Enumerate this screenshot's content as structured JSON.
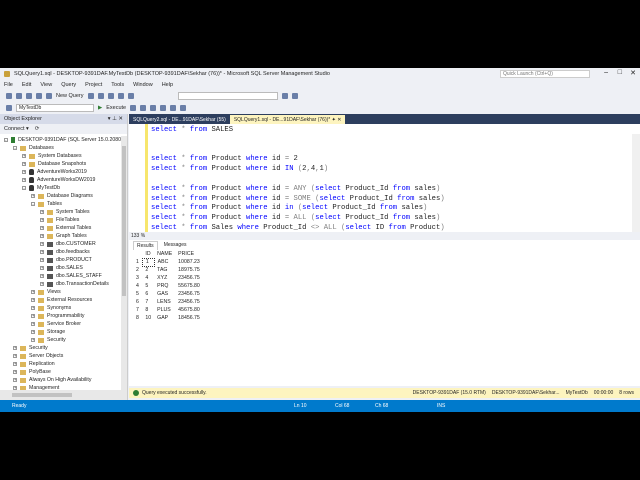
{
  "window": {
    "title": "SQLQuery1.sql - DESKTOP-9391DAF.MyTestDb (DESKTOP-9391DAF\\Sekhar (76))* - Microsoft SQL Server Management Studio",
    "quick_launch": "Quick Launch (Ctrl+Q)"
  },
  "menu": [
    "File",
    "Edit",
    "View",
    "Query",
    "Project",
    "Tools",
    "Window",
    "Help"
  ],
  "toolbar": {
    "new_query": "New Query",
    "database": "MyTestDb",
    "execute": "Execute"
  },
  "object_explorer": {
    "title": "Object Explorer",
    "connect": "Connect ▾",
    "nodes": [
      {
        "label": "DESKTOP-9391DAF (SQL Server 15.0.2080",
        "level": 0,
        "icon": "server",
        "exp": "-"
      },
      {
        "label": "Databases",
        "level": 1,
        "icon": "folder",
        "exp": "-"
      },
      {
        "label": "System Databases",
        "level": 2,
        "icon": "folder",
        "exp": "+"
      },
      {
        "label": "Database Snapshots",
        "level": 2,
        "icon": "folder",
        "exp": "+"
      },
      {
        "label": "AdventureWorks2019",
        "level": 2,
        "icon": "db",
        "exp": "+"
      },
      {
        "label": "AdventureWorksDW2019",
        "level": 2,
        "icon": "db",
        "exp": "+"
      },
      {
        "label": "MyTestDb",
        "level": 2,
        "icon": "db",
        "exp": "-"
      },
      {
        "label": "Database Diagrams",
        "level": 3,
        "icon": "folder",
        "exp": "+"
      },
      {
        "label": "Tables",
        "level": 3,
        "icon": "folder",
        "exp": "-"
      },
      {
        "label": "System Tables",
        "level": 4,
        "icon": "folder",
        "exp": "+"
      },
      {
        "label": "FileTables",
        "level": 4,
        "icon": "folder",
        "exp": "+"
      },
      {
        "label": "External Tables",
        "level": 4,
        "icon": "folder",
        "exp": "+"
      },
      {
        "label": "Graph Tables",
        "level": 4,
        "icon": "folder",
        "exp": "+"
      },
      {
        "label": "dbo.CUSTOMER",
        "level": 4,
        "icon": "table",
        "exp": "+"
      },
      {
        "label": "dbo.feedbacks",
        "level": 4,
        "icon": "table",
        "exp": "+"
      },
      {
        "label": "dbo.PRODUCT",
        "level": 4,
        "icon": "table",
        "exp": "+"
      },
      {
        "label": "dbo.SALES",
        "level": 4,
        "icon": "table",
        "exp": "+"
      },
      {
        "label": "dbo.SALES_STAFF",
        "level": 4,
        "icon": "table",
        "exp": "+"
      },
      {
        "label": "dbo.TransactionDetails",
        "level": 4,
        "icon": "table",
        "exp": "+"
      },
      {
        "label": "Views",
        "level": 3,
        "icon": "folder",
        "exp": "+"
      },
      {
        "label": "External Resources",
        "level": 3,
        "icon": "folder",
        "exp": "+"
      },
      {
        "label": "Synonyms",
        "level": 3,
        "icon": "folder",
        "exp": "+"
      },
      {
        "label": "Programmability",
        "level": 3,
        "icon": "folder",
        "exp": "+"
      },
      {
        "label": "Service Broker",
        "level": 3,
        "icon": "folder",
        "exp": "+"
      },
      {
        "label": "Storage",
        "level": 3,
        "icon": "folder",
        "exp": "+"
      },
      {
        "label": "Security",
        "level": 3,
        "icon": "folder",
        "exp": "+"
      },
      {
        "label": "Security",
        "level": 1,
        "icon": "folder",
        "exp": "+"
      },
      {
        "label": "Server Objects",
        "level": 1,
        "icon": "folder",
        "exp": "+"
      },
      {
        "label": "Replication",
        "level": 1,
        "icon": "folder",
        "exp": "+"
      },
      {
        "label": "PolyBase",
        "level": 1,
        "icon": "folder",
        "exp": "+"
      },
      {
        "label": "Always On High Availability",
        "level": 1,
        "icon": "folder",
        "exp": "+"
      },
      {
        "label": "Management",
        "level": 1,
        "icon": "folder",
        "exp": "+"
      }
    ]
  },
  "tabs": [
    {
      "label": "SQLQuery2.sql - DE...91DAF\\Sekhar (55)",
      "active": false
    },
    {
      "label": "SQLQuery1.sql - DE...91DAF\\Sekhar (76))*  ✦  ✕",
      "active": true
    }
  ],
  "editor": {
    "lines": [
      "select * from SALES",
      "",
      "",
      "select * from Product where id = 2",
      "select * from Product where id IN (2,4,1)",
      "",
      "select * from Product where id = ANY (select Product_Id from sales)",
      "select * from Product where id = SOME (select Product_Id from sales)",
      "select * from Product where id in (select Product_Id from sales)",
      "select * from Product where id = ALL (select Product_Id from sales)",
      "select * from Sales where Product_Id <> ALL (select ID from Product)"
    ],
    "zoom": "133 %"
  },
  "results": {
    "tabs": [
      "Results",
      "Messages"
    ],
    "columns": [
      "",
      "ID",
      "NAME",
      "PRICE"
    ],
    "rows": [
      [
        "1",
        "1",
        "ABC",
        "10087.23"
      ],
      [
        "2",
        "2",
        "TAG",
        "18975.75"
      ],
      [
        "3",
        "4",
        "XYZ",
        "23456.75"
      ],
      [
        "4",
        "5",
        "PRQ",
        "55675.80"
      ],
      [
        "5",
        "6",
        "GAS",
        "23456.75"
      ],
      [
        "6",
        "7",
        "LENS",
        "23456.75"
      ],
      [
        "7",
        "8",
        "PLUS",
        "45675.80"
      ],
      [
        "8",
        "10",
        "GAP",
        "18456.75"
      ]
    ]
  },
  "query_status": {
    "message": "Query executed successfully.",
    "server": "DESKTOP-9391DAF (15.0 RTM)",
    "user": "DESKTOP-9391DAF\\Sekhar...",
    "db": "MyTestDb",
    "time": "00:00:00",
    "rows": "8 rows"
  },
  "status": {
    "ready": "Ready",
    "ln": "Ln 10",
    "col": "Col 68",
    "ch": "Ch 68",
    "ins": "INS"
  }
}
